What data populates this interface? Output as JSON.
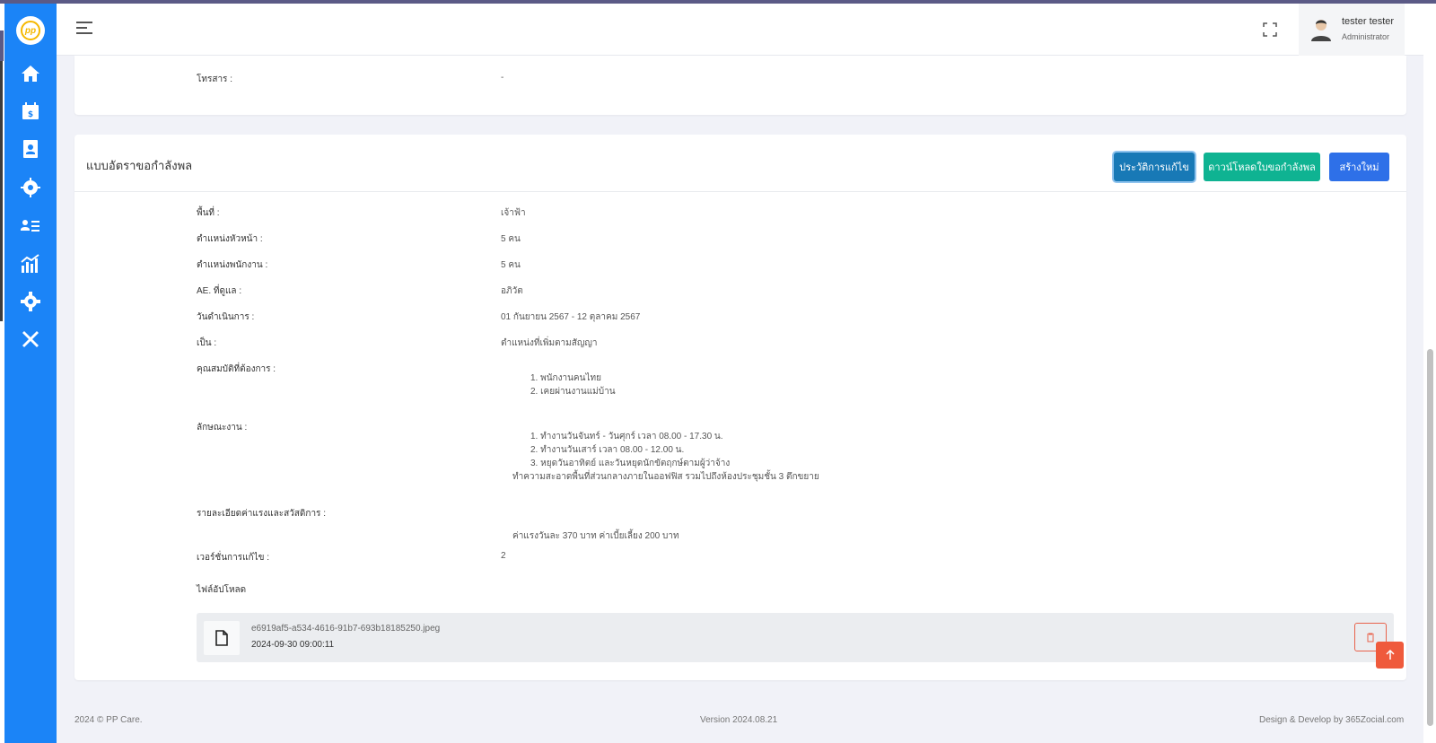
{
  "app": {
    "logo_text": "pp",
    "accent": "#1b84f7"
  },
  "sidebar": {
    "items": [
      {
        "icon": "home-icon"
      },
      {
        "icon": "calendar-money-icon"
      },
      {
        "icon": "contact-book-icon"
      },
      {
        "icon": "users-gear-icon"
      },
      {
        "icon": "user-list-icon"
      },
      {
        "icon": "chart-bar-icon"
      },
      {
        "icon": "gear-icon"
      },
      {
        "icon": "tools-icon"
      }
    ]
  },
  "header": {
    "user_name": "tester tester",
    "user_role": "Administrator"
  },
  "card1": {
    "fax_label": "โทรสาร :",
    "fax_value": "-"
  },
  "card2": {
    "title": "แบบอัตราขอกำลังพล",
    "btn_history": "ประวัติการแก้ไข",
    "btn_download": "ดาวน์โหลดใบขอกำลังพล",
    "btn_new": "สร้างใหม่",
    "fields": {
      "area_label": "พื้นที่ :",
      "area_value": "เจ้าฟ้า",
      "head_label": "ตำแหน่งหัวหน้า :",
      "head_value": "5 คน",
      "staff_label": "ตำแหน่งพนักงาน :",
      "staff_value": "5 คน",
      "ae_label": "AE. ที่ดูแล :",
      "ae_value": "อภิวัต",
      "date_label": "วันดำเนินการ :",
      "date_value": "01 กันยายน 2567 - 12 ตุลาคม 2567",
      "type_label": "เป็น :",
      "type_value": "ตำแหน่งที่เพิ่มตามสัญญา",
      "qual_label": "คุณสมบัติที่ต้องการ :",
      "qual_items": [
        "1. พนักงานคนไทย",
        "2. เคยผ่านงานแม่บ้าน"
      ],
      "work_label": "ลักษณะงาน :",
      "work_items": [
        "1. ทำงานวันจันทร์ - วันศุกร์ เวลา 08.00 - 17.30 น.",
        "2. ทำงานวันเสาร์ เวลา 08.00 - 12.00 น.",
        "3. หยุดวันอาทิตย์ และวันหยุดนักขัตฤกษ์ตามผู้ว่าจ้าง"
      ],
      "work_note": "ทำความสะอาดพื้นที่ส่วนกลางภายในออฟฟิส รวมไปถึงห้องประชุมชั้น 3 ตึกขยาย",
      "wage_label": "รายละเอียดค่าแรงและสวัสดิการ :",
      "wage_value": "ค่าแรงวันละ 370 บาท ค่าเบี้ยเลี้ยง 200 บาท",
      "version_label": "เวอร์ชั่นการแก้ไข :",
      "version_value": "2",
      "upload_label": "ไฟล์อัปโหลด"
    },
    "file": {
      "name": "e6919af5-a534-4616-91b7-693b18185250.jpeg",
      "date": "2024-09-30 09:00:11"
    }
  },
  "footer": {
    "left": "2024 © PP Care.",
    "center": "Version 2024.08.21",
    "right": "Design & Develop by 365Zocial.com"
  }
}
